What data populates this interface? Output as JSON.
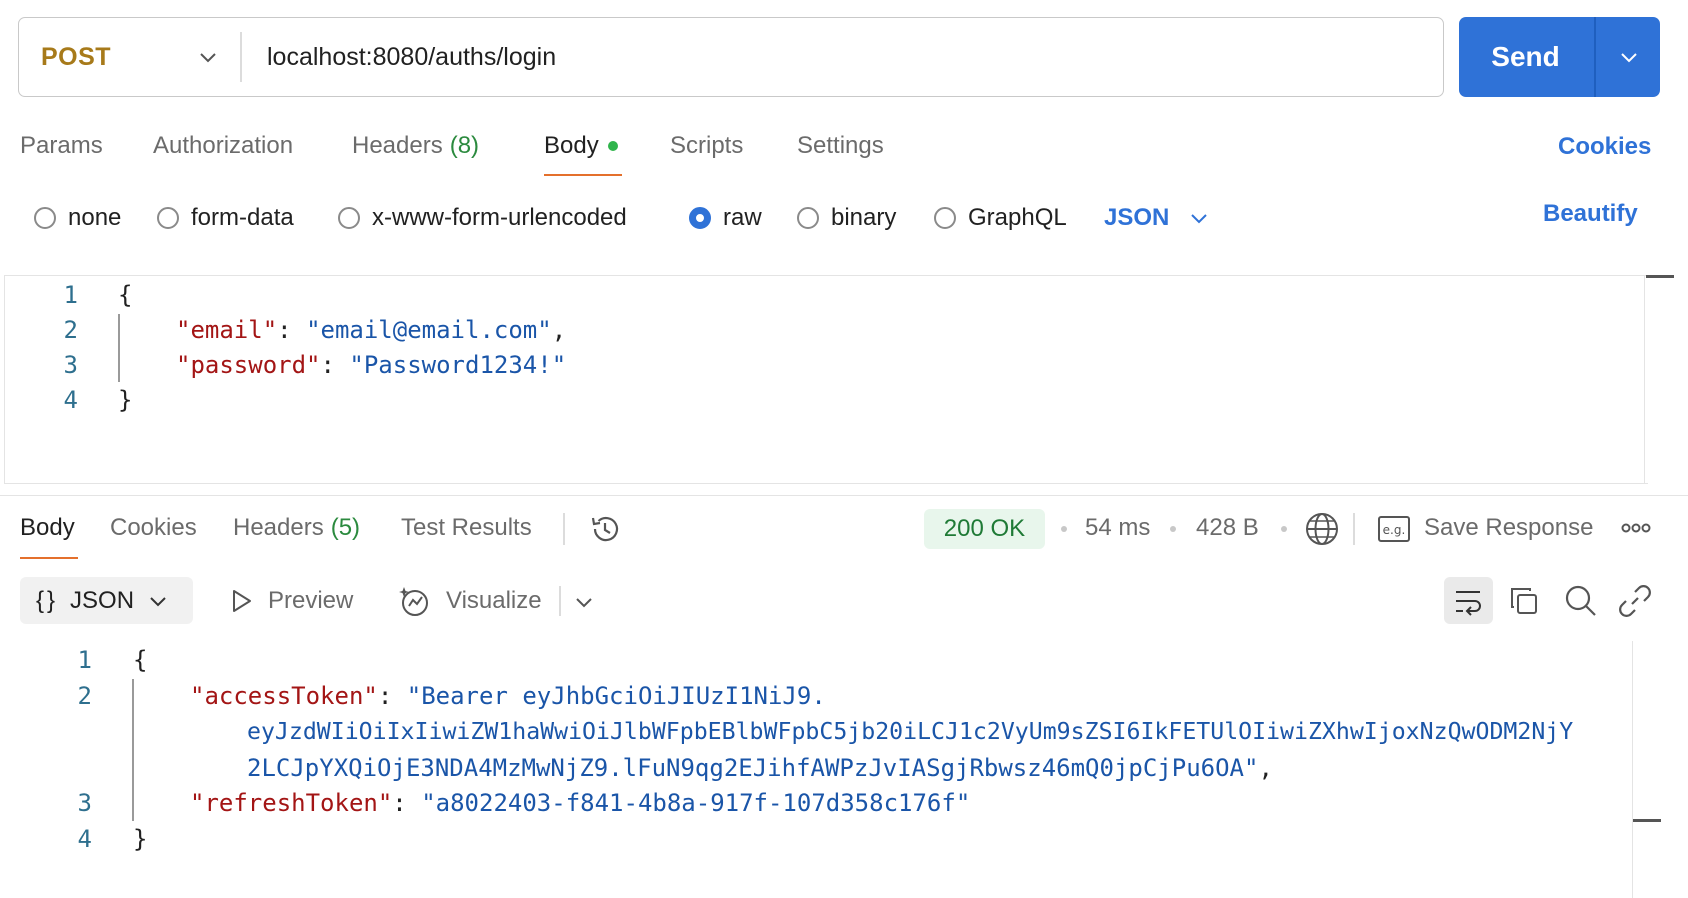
{
  "request": {
    "method": "POST",
    "url": "localhost:8080/auths/login",
    "send_label": "Send"
  },
  "request_tabs": [
    {
      "label": "Params"
    },
    {
      "label": "Authorization"
    },
    {
      "label": "Headers",
      "count": "(8)"
    },
    {
      "label": "Body",
      "active": true
    },
    {
      "label": "Scripts"
    },
    {
      "label": "Settings"
    }
  ],
  "cookies_link": "Cookies",
  "body_types": [
    "none",
    "form-data",
    "x-www-form-urlencoded",
    "raw",
    "binary",
    "GraphQL"
  ],
  "selected_body_type": "raw",
  "body_format": "JSON",
  "beautify_label": "Beautify",
  "request_body": {
    "line_numbers": [
      "1",
      "2",
      "3",
      "4"
    ],
    "open_brace": "{",
    "close_brace": "}",
    "email_key": "\"email\"",
    "email_value": "\"email@email.com\"",
    "password_key": "\"password\"",
    "password_value": "\"Password1234!\"",
    "colon": ":",
    "comma": ","
  },
  "response_tabs": [
    {
      "label": "Body",
      "active": true
    },
    {
      "label": "Cookies"
    },
    {
      "label": "Headers",
      "count": "(5)"
    },
    {
      "label": "Test Results"
    }
  ],
  "response_meta": {
    "status": "200 OK",
    "time": "54 ms",
    "size": "428 B",
    "save_label": "Save Response"
  },
  "response_toolbar": {
    "format": "JSON",
    "braces": "{}",
    "preview": "Preview",
    "visualize": "Visualize"
  },
  "response_body": {
    "line_numbers": [
      "1",
      "2",
      "3",
      "4"
    ],
    "open_brace": "{",
    "close_brace": "}",
    "access_key": "\"accessToken\"",
    "access_line1": "\"Bearer eyJhbGciOiJIUzI1NiJ9.",
    "access_line2": "eyJzdWIiOiIxIiwiZW1haWwiOiJlbWFpbEBlbWFpbC5jb20iLCJ1c2VyUm9sZSI6IkFETUlOIiwiZXhwIjoxNzQwODM2NjY",
    "access_line3": "2LCJpYXQiOjE3NDA4MzMwNjZ9.lFuN9qg2EJihfAWPzJvIASgjRbwsz46mQ0jpCjPu6OA\"",
    "refresh_key": "\"refreshToken\"",
    "refresh_value": "\"a8022403-f841-4b8a-917f-107d358c176f\"",
    "colon": ":",
    "comma": ","
  },
  "colors": {
    "accent": "#2f72d7",
    "method": "#a77a1a",
    "tab_underline": "#e4702c",
    "status_ok_bg": "#e8f6ec",
    "status_ok_text": "#1f7a36",
    "json_key": "#a31515",
    "json_string": "#1a55a8"
  }
}
